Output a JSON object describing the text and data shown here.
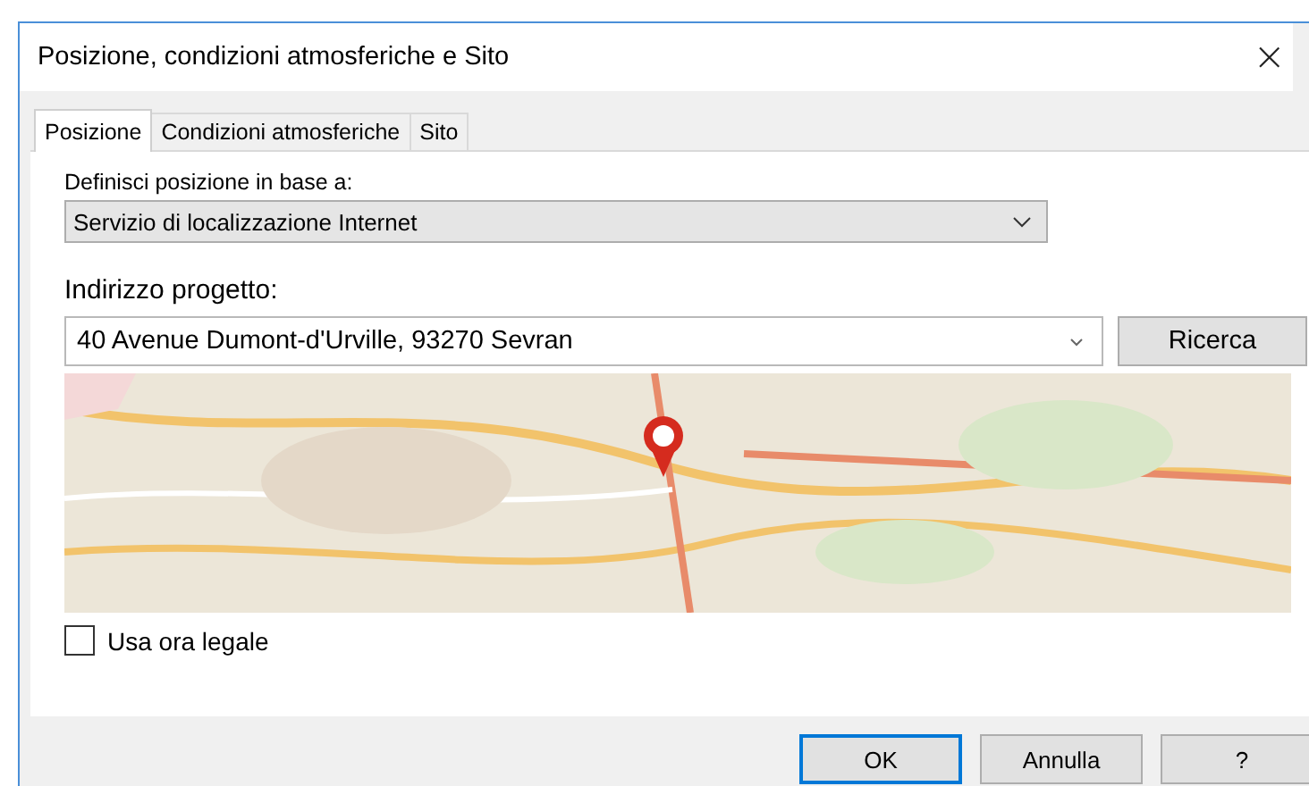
{
  "window": {
    "title": "Posizione, condizioni atmosferiche e Sito",
    "close": "×"
  },
  "tabs": [
    {
      "label": "Posizione",
      "selected": true
    },
    {
      "label": "Condizioni atmosferiche",
      "selected": false
    },
    {
      "label": "Sito",
      "selected": false
    }
  ],
  "location_source": {
    "label": "Definisci posizione in base a:",
    "value": "Servizio di localizzazione Internet"
  },
  "address": {
    "label": "Indirizzo progetto:",
    "value": "40 Avenue Dumont-d'Urville, 93270 Sevran",
    "search_button": "Ricerca"
  },
  "daylight_saving": {
    "label": "Usa ora legale",
    "checked": false
  },
  "buttons": [
    {
      "label": "OK",
      "default": true
    },
    {
      "label": "Annulla",
      "default": false
    },
    {
      "label": "?",
      "default": false
    }
  ]
}
